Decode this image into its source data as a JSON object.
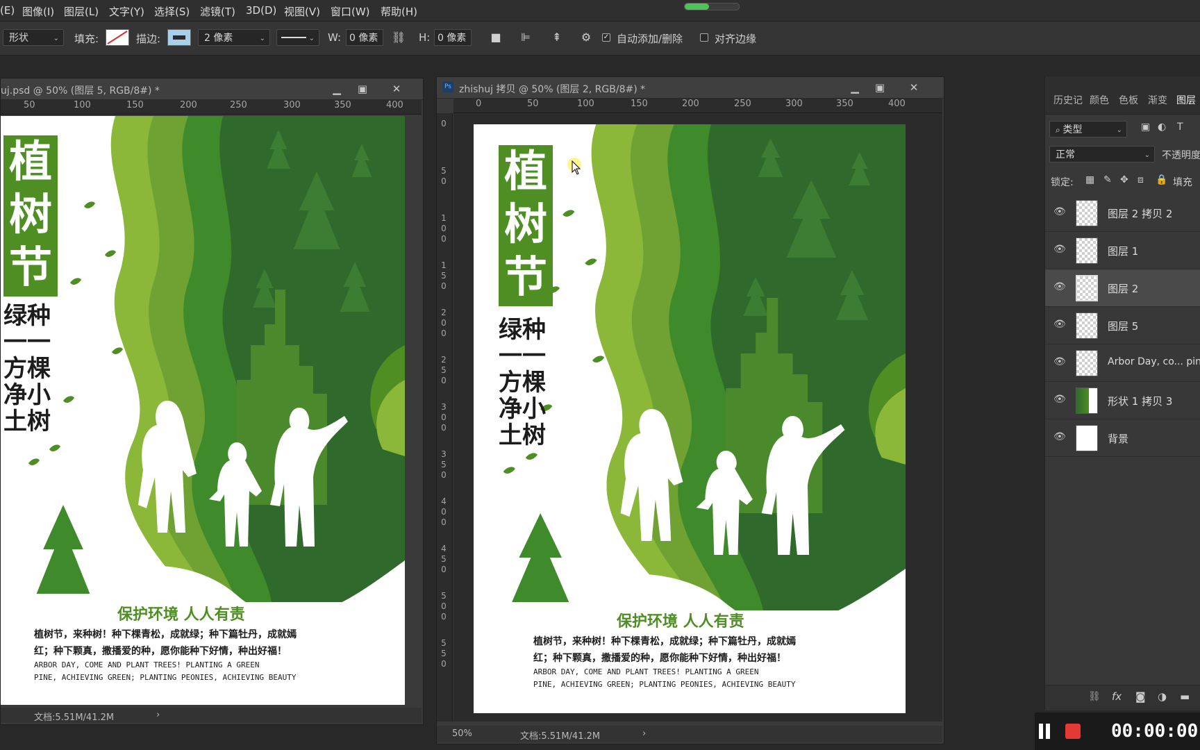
{
  "menubar": {
    "items": [
      "(E)",
      "图像(I)",
      "图层(L)",
      "文字(Y)",
      "选择(S)",
      "滤镜(T)",
      "3D(D)",
      "视图(V)",
      "窗口(W)",
      "帮助(H)"
    ],
    "progress": 0.45
  },
  "options_bar": {
    "mode": "形状",
    "fill_label": "填充:",
    "stroke_label": "描边:",
    "stroke_width": "2 像素",
    "w_label": "W:",
    "w_value": "0 像素",
    "h_label": "H:",
    "h_value": "0 像素",
    "auto_add_delete_label": "自动添加/删除",
    "auto_add_delete_checked": true,
    "align_edges_label": "对齐边缘",
    "align_edges_checked": false,
    "colors": {
      "fill_none_slash": "#d23030",
      "stroke_fill": "#a9d0ea"
    }
  },
  "doc_left": {
    "title": "uj.psd @ 50% (图层 5, RGB/8#) *",
    "ruler": [
      "50",
      "100",
      "150",
      "200",
      "250",
      "300",
      "350",
      "400"
    ],
    "status": "文档:5.51M/41.2M"
  },
  "doc_right": {
    "title": "zhishuj 拷贝 @ 50% (图层 2, RGB/8#) *",
    "ruler": [
      "0",
      "50",
      "100",
      "150",
      "200",
      "250",
      "300",
      "350",
      "400"
    ],
    "vruler": [
      "0",
      "50",
      "100",
      "150",
      "200",
      "250",
      "300",
      "350",
      "400",
      "450",
      "500",
      "550"
    ],
    "zoom": "50%",
    "status": "文档:5.51M/41.2M"
  },
  "poster": {
    "title_chars": [
      "植",
      "树",
      "节"
    ],
    "sub_lines": [
      "绿种",
      "一一",
      "方棵",
      "净小",
      "土树"
    ],
    "slogan": "保护环境  人人有责",
    "body_cn_1": "植树节，来种树！种下棵青松，成就绿；种下篇牡丹，成就嫣",
    "body_cn_2": "红；种下颗真，撒播爱的种，愿你能种下好情，种出好福！",
    "body_en_1": "ARBOR DAY, COME AND PLANT TREES! PLANTING A GREEN",
    "body_en_2": "PINE, ACHIEVING GREEN; PLANTING PEONIES, ACHIEVING BEAUTY",
    "colors": {
      "dark_green": "#2f6a2c",
      "mid_green": "#3f8a2a",
      "light_green": "#8cb83a",
      "title_green": "#4e8e22"
    }
  },
  "layers_panel": {
    "tabs": [
      "历史记",
      "颜色",
      "色板",
      "渐变",
      "图层"
    ],
    "active_tab": "图层",
    "filter_kind": "类型",
    "blend_mode": "正常",
    "opacity_label": "不透明度",
    "lock_label": "锁定:",
    "fill_label": "填充",
    "layers": [
      {
        "name": "图层 2 拷贝 2",
        "selected": false
      },
      {
        "name": "图层 1",
        "selected": false
      },
      {
        "name": "图层 2",
        "selected": true
      },
      {
        "name": "图层 5",
        "selected": false
      },
      {
        "name": "Arbor Day, co... pine",
        "selected": false
      },
      {
        "name": "形状 1 拷贝 3",
        "selected": false
      },
      {
        "name": "背景",
        "selected": false
      }
    ]
  },
  "recorder": {
    "time": "00:00:00"
  }
}
